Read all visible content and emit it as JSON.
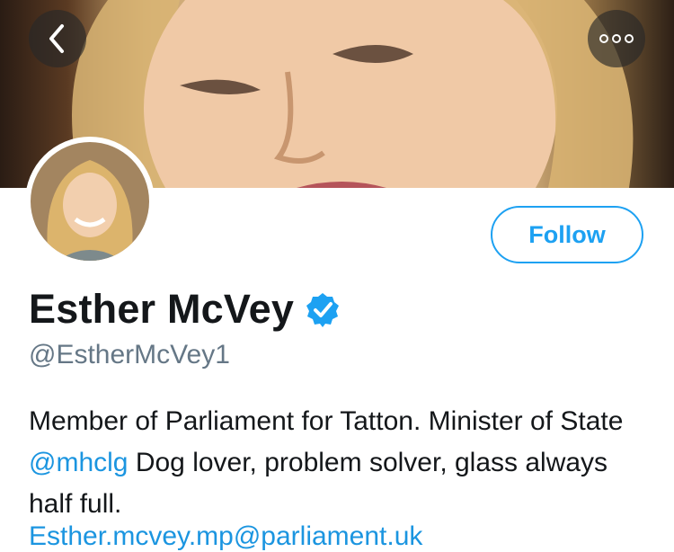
{
  "header": {
    "back_icon": "chevron-left-icon",
    "more_icon": "more-dots-icon"
  },
  "profile": {
    "display_name": "Esther McVey",
    "verified_icon": "verified-badge-icon",
    "handle": "@EstherMcVey1",
    "follow_label": "Follow",
    "bio": {
      "line_pre": "Member of Parliament for Tatton. Minister of State ",
      "mention": "@mhclg",
      "line_post": " Dog lover, problem solver, glass always half full."
    },
    "link": "Esther.mcvey.mp@parliament.uk"
  },
  "colors": {
    "accent": "#1da1f2",
    "link": "#1b95e0",
    "handle_gray": "#657786",
    "text": "#14171a"
  }
}
